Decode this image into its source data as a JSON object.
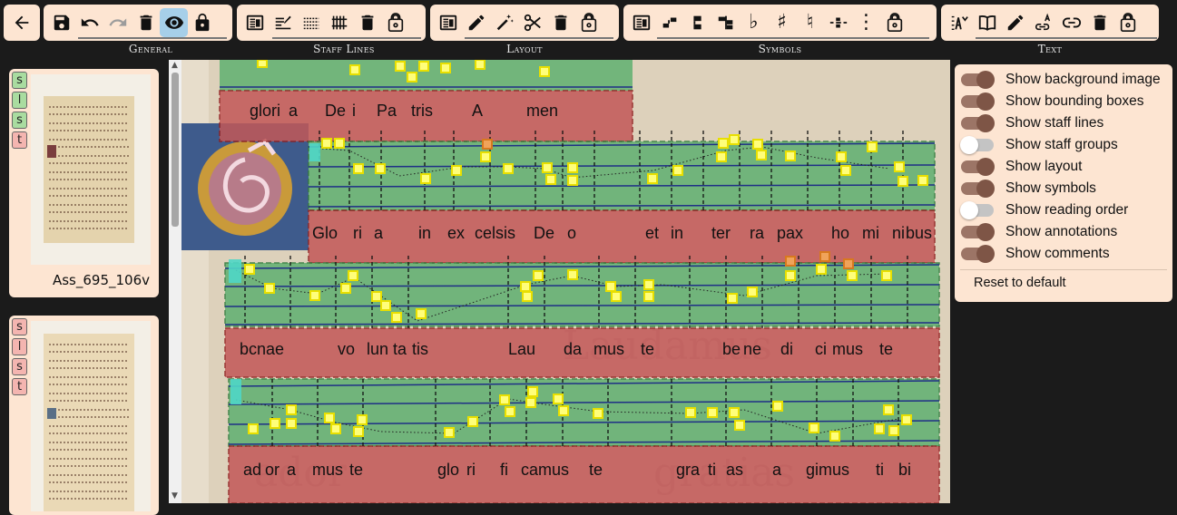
{
  "toolbar": {
    "groups": [
      {
        "label": "General",
        "tools": [
          "back-arrow-icon",
          "save-icon",
          "undo-icon",
          "redo-icon",
          "delete-icon",
          "visibility-icon",
          "lock-icon"
        ]
      },
      {
        "label": "Staff Lines",
        "tools": [
          "staff-add-icon",
          "staff-edit-icon",
          "staff-split-icon",
          "staff-lines-icon",
          "delete-icon",
          "lock-icon"
        ]
      },
      {
        "label": "Layout",
        "tools": [
          "layout-add-icon",
          "pencil-icon",
          "magic-wand-icon",
          "cut-icon",
          "delete-icon",
          "lock-icon"
        ]
      },
      {
        "label": "Symbols",
        "tools": [
          "symbol-add-icon",
          "neume-icon",
          "clef-c-icon",
          "clef-f-icon",
          "flat-icon",
          "sharp-icon",
          "natural-icon",
          "custos-icon",
          "more-icon",
          "lock-icon"
        ]
      },
      {
        "label": "Text",
        "tools": [
          "text-sort-icon",
          "book-icon",
          "pencil-icon",
          "text-link-icon",
          "link-icon",
          "delete-icon",
          "lock-icon"
        ]
      }
    ],
    "glyph_flat": "♭",
    "glyph_sharp": "♯",
    "glyph_natural": "♮",
    "glyph_more": "⋮"
  },
  "pages": [
    {
      "name": "Ass_695_106v",
      "badges": [
        "s",
        "l",
        "s",
        "t"
      ]
    },
    {
      "name": "",
      "badges": [
        "s",
        "l",
        "s",
        "t"
      ]
    }
  ],
  "settings": {
    "options": [
      {
        "label": "Show background image",
        "on": true
      },
      {
        "label": "Show bounding boxes",
        "on": true
      },
      {
        "label": "Show staff lines",
        "on": true
      },
      {
        "label": "Show staff groups",
        "on": false
      },
      {
        "label": "Show layout",
        "on": true
      },
      {
        "label": "Show symbols",
        "on": true
      },
      {
        "label": "Show reading order",
        "on": false
      },
      {
        "label": "Show annotations",
        "on": true
      },
      {
        "label": "Show comments",
        "on": true
      }
    ],
    "reset_label": "Reset to default"
  },
  "manuscript": {
    "text_lines": [
      [
        "glori",
        "a",
        "De",
        "i",
        "Pa",
        "tris",
        "A",
        "men"
      ],
      [
        "Glo",
        "ri",
        "a",
        "in",
        "ex",
        "celsis",
        "De",
        "o",
        "et",
        "in",
        "ter",
        "ra",
        "pax",
        "ho",
        "mi",
        "ni",
        "bus"
      ],
      [
        "bcnae",
        "vo",
        "lun",
        "ta",
        "tis",
        "Lau",
        "da",
        "mus",
        "te",
        "be",
        "ne",
        "di",
        "ci",
        "mus",
        "te"
      ],
      [
        "ad",
        "or",
        "a",
        "mus",
        "te",
        "glo",
        "ri",
        "fi",
        "camus",
        "te",
        "gra",
        "ti",
        "as",
        "a",
        "gimus",
        "ti",
        "bi"
      ]
    ]
  },
  "colors": {
    "staff_region": "#5fb070",
    "text_region": "#c25858",
    "symbol_box": "#ffff00",
    "accent_selected": "#a6cfe9",
    "panel": "#fde5d2"
  }
}
